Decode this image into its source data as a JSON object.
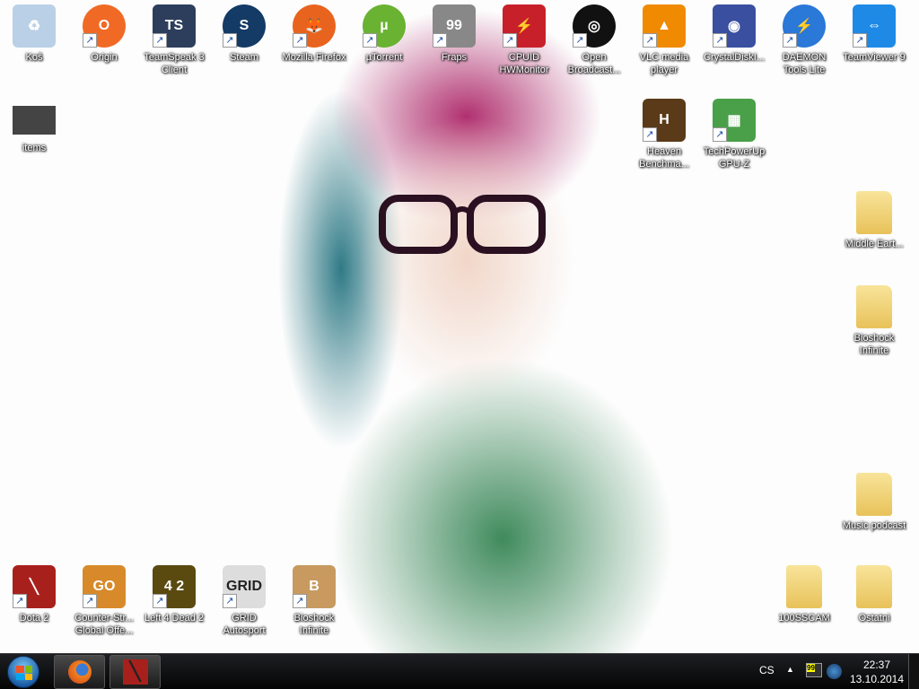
{
  "desktop": {
    "icons": [
      {
        "label": "Koš",
        "icon": "recycle-bin-icon",
        "color": "#b9d0e6",
        "glyph": "♻",
        "shortcut": false
      },
      {
        "label": "Origin",
        "icon": "origin-icon",
        "color": "#f06a26",
        "glyph": "O",
        "shortcut": true
      },
      {
        "label": "TeamSpeak 3 Client",
        "icon": "teamspeak-icon",
        "color": "#2c3e5c",
        "glyph": "TS",
        "shortcut": true
      },
      {
        "label": "Steam",
        "icon": "steam-icon",
        "color": "#143a66",
        "glyph": "S",
        "shortcut": true
      },
      {
        "label": "Mozilla Firefox",
        "icon": "firefox-icon",
        "color": "#e8641e",
        "glyph": "🦊",
        "shortcut": true
      },
      {
        "label": "µTorrent",
        "icon": "utorrent-icon",
        "color": "#6ab232",
        "glyph": "µ",
        "shortcut": true
      },
      {
        "label": "Fraps",
        "icon": "fraps-icon",
        "color": "#888888",
        "glyph": "99",
        "shortcut": true
      },
      {
        "label": "CPUID HWMonitor",
        "icon": "hwmonitor-icon",
        "color": "#c8202a",
        "glyph": "⚡",
        "shortcut": true
      },
      {
        "label": "Open Broadcast...",
        "icon": "obs-icon",
        "color": "#111111",
        "glyph": "◎",
        "shortcut": true
      },
      {
        "label": "VLC media player",
        "icon": "vlc-icon",
        "color": "#f08a00",
        "glyph": "▲",
        "shortcut": true
      },
      {
        "label": "CrystalDiskI...",
        "icon": "crystaldiskinfo-icon",
        "color": "#3a4fa0",
        "glyph": "◉",
        "shortcut": true
      },
      {
        "label": "DAEMON Tools Lite",
        "icon": "daemon-tools-icon",
        "color": "#2a78d8",
        "glyph": "⚡",
        "shortcut": true
      },
      {
        "label": "TeamViewer 9",
        "icon": "teamviewer-icon",
        "color": "#1e8ae6",
        "glyph": "⇔",
        "shortcut": true
      },
      {
        "label": "items",
        "icon": "folder-thumbnail-icon",
        "color": "#444444",
        "glyph": "",
        "shortcut": false
      },
      {
        "label": "Heaven Benchma...",
        "icon": "heaven-benchmark-icon",
        "color": "#5a3a18",
        "glyph": "H",
        "shortcut": true
      },
      {
        "label": "TechPowerUp GPU-Z",
        "icon": "gpu-z-icon",
        "color": "#4aa048",
        "glyph": "▦",
        "shortcut": true
      },
      {
        "label": "Middle Eart...",
        "icon": "folder-icon",
        "color": "#f0d070",
        "glyph": "",
        "shortcut": false,
        "folder": true
      },
      {
        "label": "Bioshock Infinite",
        "icon": "folder-icon",
        "color": "#f0d070",
        "glyph": "",
        "shortcut": false,
        "folder": true
      },
      {
        "label": "Music podcast",
        "icon": "folder-icon",
        "color": "#f0d070",
        "glyph": "",
        "shortcut": false,
        "folder": true
      },
      {
        "label": "Dota 2",
        "icon": "dota2-icon",
        "color": "#a8201c",
        "glyph": "╲",
        "shortcut": true
      },
      {
        "label": "Counter-Str... Global Offe...",
        "icon": "csgo-icon",
        "color": "#d88a2a",
        "glyph": "GO",
        "shortcut": true
      },
      {
        "label": "Left 4 Dead 2",
        "icon": "left4dead2-icon",
        "color": "#5a4a10",
        "glyph": "4 2",
        "shortcut": true
      },
      {
        "label": "GRID Autosport",
        "icon": "grid-autosport-icon",
        "color": "#dddddd",
        "glyph": "GRID",
        "shortcut": true
      },
      {
        "label": "Bioshock Infinite",
        "icon": "bioshock-icon",
        "color": "#c89a60",
        "glyph": "B",
        "shortcut": true
      },
      {
        "label": "100SSCAM",
        "icon": "folder-icon",
        "color": "#f0d070",
        "glyph": "",
        "shortcut": false,
        "folder": true
      },
      {
        "label": "Ostatni",
        "icon": "folder-icon",
        "color": "#f0d070",
        "glyph": "",
        "shortcut": false,
        "folder": true
      }
    ]
  },
  "taskbar": {
    "pinned": [
      {
        "name": "firefox",
        "icon": "firefox-icon"
      },
      {
        "name": "dota2",
        "icon": "dota2-icon"
      }
    ],
    "tray": {
      "language": "CS",
      "time": "22:37",
      "date": "13.10.2014",
      "fraps_badge": "99"
    }
  }
}
